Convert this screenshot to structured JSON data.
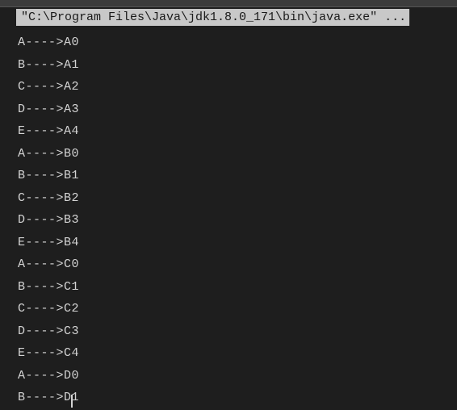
{
  "header": {
    "command": "\"C:\\Program Files\\Java\\jdk1.8.0_171\\bin\\java.exe\" ..."
  },
  "output": {
    "lines": [
      "A---->A0",
      "B---->A1",
      "C---->A2",
      "D---->A3",
      "E---->A4",
      "A---->B0",
      "B---->B1",
      "C---->B2",
      "D---->B3",
      "E---->B4",
      "A---->C0",
      "B---->C1",
      "C---->C2",
      "D---->C3",
      "E---->C4",
      "A---->D0",
      "B---->D1"
    ]
  }
}
